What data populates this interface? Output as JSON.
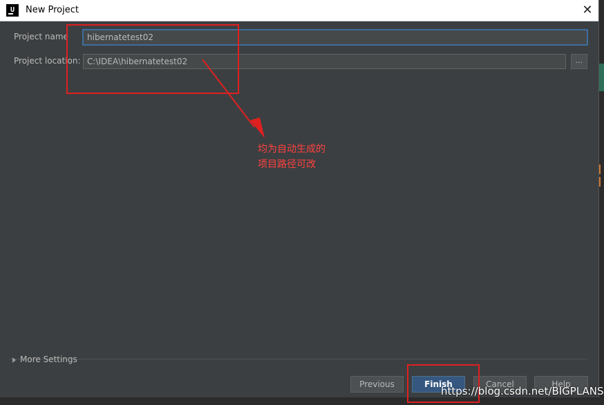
{
  "window": {
    "title": "New Project",
    "icon_letter": "U"
  },
  "form": {
    "project_name_label": "Project name",
    "project_name_value": "hibernatetest02",
    "project_location_label": "Project location:",
    "project_location_value": "C:\\IDEA\\hibernatetest02",
    "browse_label": "..."
  },
  "more_settings": "More Settings",
  "buttons": {
    "previous": "Previous",
    "finish": "Finish",
    "cancel": "Cancel",
    "help": "Help"
  },
  "annotation": {
    "line1": "均为自动生成的",
    "line2": "项目路径可改",
    "color": "#e02020"
  },
  "watermark": "https://blog.csdn.net/BIGPLANS",
  "colors": {
    "dialog_bg": "#3c3f41",
    "primary_button": "#365880",
    "focus_border": "#3e6e9e"
  }
}
